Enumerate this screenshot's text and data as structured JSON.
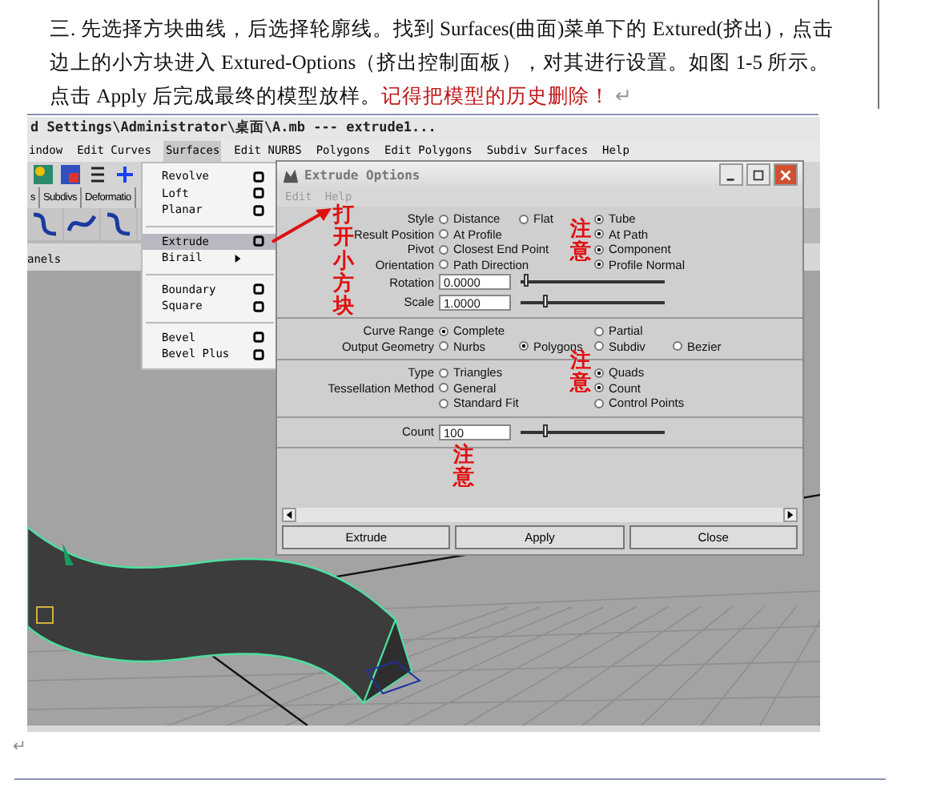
{
  "document": {
    "paragraph": {
      "text": "三.   先选择方块曲线，后选择轮廓线。找到 Surfaces(曲面)菜单下的 Extured(挤出)，点击边上的小方块进入 Extured-Options（挤出控制面板），对其进行设置。如图 1-5 所示。点击 Apply 后完成最终的模型放样。",
      "warning": "记得把模型的历史删除！",
      "mark": "↵"
    },
    "end_mark": "↵"
  },
  "screenshot": {
    "title_bar": {
      "title": "d Settings\\Administrator\\桌面\\A.mb   ---   extrude1..."
    },
    "menu_bar": [
      {
        "label": "indow",
        "selected": false
      },
      {
        "label": "Edit Curves",
        "selected": false
      },
      {
        "label": "Surfaces",
        "selected": true
      },
      {
        "label": "Edit NURBS",
        "selected": false
      },
      {
        "label": "Polygons",
        "selected": false
      },
      {
        "label": "Edit Polygons",
        "selected": false
      },
      {
        "label": "Subdiv Surfaces",
        "selected": false
      },
      {
        "label": "Help",
        "selected": false
      }
    ],
    "shelf_tabs": [
      "s",
      "Subdivs",
      "Deformatio"
    ],
    "panel_menu": "anels",
    "surfaces_menu": [
      [
        {
          "label": "Revolve",
          "kind": "option",
          "selected": false
        },
        {
          "label": "Loft",
          "kind": "option",
          "selected": false
        },
        {
          "label": "Planar",
          "kind": "option",
          "selected": false
        }
      ],
      [
        {
          "label": "Extrude",
          "kind": "option",
          "selected": true
        },
        {
          "label": "Birail",
          "kind": "submenu",
          "selected": false
        }
      ],
      [
        {
          "label": "Boundary",
          "kind": "option",
          "selected": false
        },
        {
          "label": "Square",
          "kind": "option",
          "selected": false
        }
      ],
      [
        {
          "label": "Bevel",
          "kind": "option",
          "selected": false
        },
        {
          "label": "Bevel Plus",
          "kind": "option",
          "selected": false
        }
      ]
    ],
    "dialog": {
      "title": "Extrude Options",
      "menu": [
        {
          "label": "Edit",
          "disabled": true
        },
        {
          "label": "Help",
          "disabled": true
        }
      ],
      "sections": [
        {
          "rows": [
            {
              "kind": "radio",
              "label": "Style",
              "options": [
                {
                  "label": "Distance",
                  "selected": false
                },
                {
                  "label": "Flat",
                  "selected": false
                },
                {
                  "label": "Tube",
                  "selected": true
                }
              ]
            },
            {
              "kind": "radio",
              "label": "Result Position",
              "options": [
                {
                  "label": "At Profile",
                  "selected": false
                },
                {
                  "label": "At Path",
                  "selected": true
                }
              ]
            },
            {
              "kind": "radio",
              "label": "Pivot",
              "options": [
                {
                  "label": "Closest End Point",
                  "selected": false
                },
                {
                  "label": "Component",
                  "selected": true
                }
              ]
            },
            {
              "kind": "radio",
              "label": "Orientation",
              "options": [
                {
                  "label": "Path Direction",
                  "selected": false
                },
                {
                  "label": "Profile Normal",
                  "selected": true
                }
              ]
            },
            {
              "kind": "slider",
              "label": "Rotation",
              "value": "0.0000",
              "level": 0.02
            },
            {
              "kind": "slider",
              "label": "Scale",
              "value": "1.0000",
              "level": 0.15
            }
          ]
        },
        {
          "rows": [
            {
              "kind": "radio",
              "label": "Curve Range",
              "options": [
                {
                  "label": "Complete",
                  "selected": true
                },
                {
                  "label": "Partial",
                  "selected": false
                }
              ]
            },
            {
              "kind": "radio",
              "label": "Output Geometry",
              "options": [
                {
                  "label": "Nurbs",
                  "selected": false
                },
                {
                  "label": "Polygons",
                  "selected": true
                },
                {
                  "label": "Subdiv",
                  "selected": false
                },
                {
                  "label": "Bezier",
                  "selected": false
                }
              ]
            }
          ]
        },
        {
          "rows": [
            {
              "kind": "radio",
              "label": "Type",
              "options": [
                {
                  "label": "Triangles",
                  "selected": false
                },
                {
                  "label": "Quads",
                  "selected": true
                }
              ]
            },
            {
              "kind": "radio",
              "label": "Tessellation Method",
              "options": [
                {
                  "label": "General",
                  "selected": false
                },
                {
                  "label": "Count",
                  "selected": true
                }
              ]
            },
            {
              "kind": "radio",
              "options": [
                {
                  "label": "Standard Fit",
                  "selected": false
                },
                {
                  "label": "Control Points",
                  "selected": false
                }
              ]
            }
          ]
        },
        {
          "rows": [
            {
              "kind": "slider",
              "label": "Count",
              "value": "100",
              "level": 0.15
            }
          ]
        }
      ],
      "buttons": [
        "Extrude",
        "Apply",
        "Close"
      ]
    },
    "annotations": {
      "open_box": "打开小方块",
      "notes": [
        "注意",
        "注意",
        "注意"
      ]
    }
  }
}
